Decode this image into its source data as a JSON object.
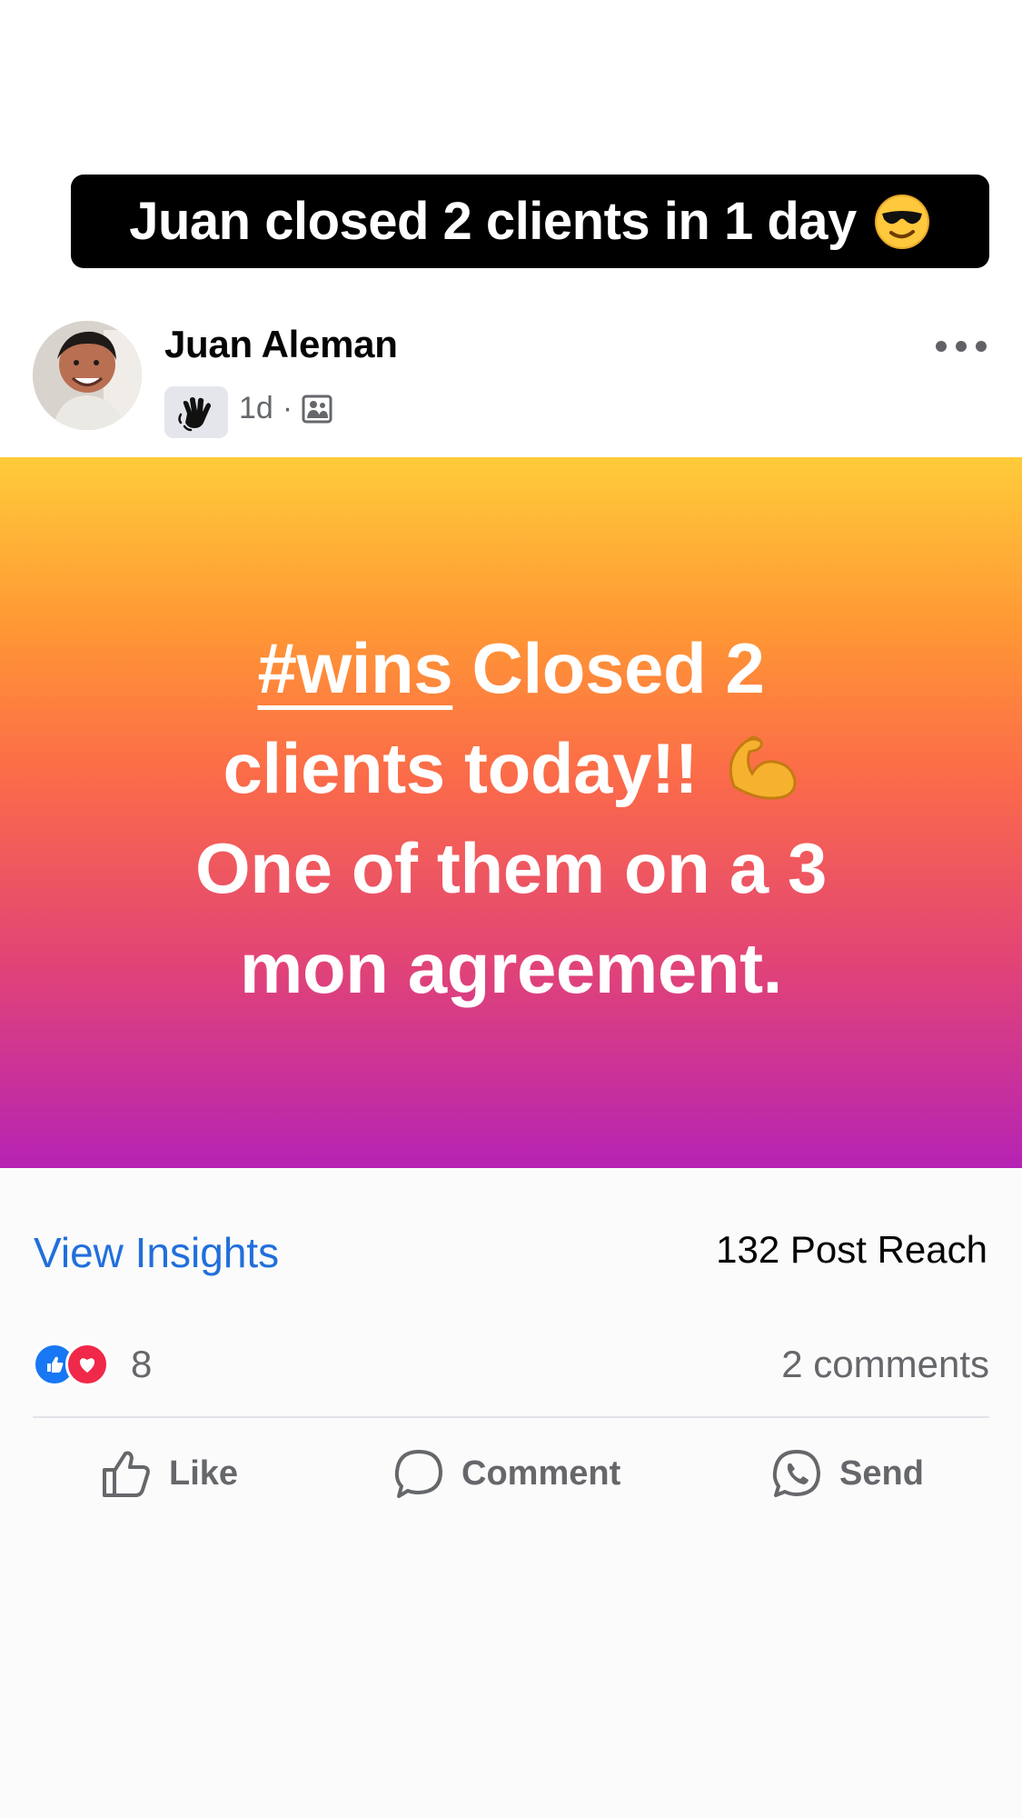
{
  "caption": {
    "text": "Juan closed 2 clients in 1 day",
    "emoji_icon": "sunglasses-face"
  },
  "post": {
    "author": "Juan Aleman",
    "time": "1d",
    "separator": "·",
    "badge_icon": "waving-hand",
    "audience_icon": "group-photo",
    "menu_icon": "more-dots",
    "content": {
      "hashtag": "#wins",
      "line1_rest": " Closed 2",
      "line2": "clients today!! ",
      "line3": "One of them on a 3",
      "line4": "mon agreement.",
      "emoji_icon": "flexed-biceps"
    },
    "background_colors": [
      "#ffcc3a",
      "#fb6b49",
      "#b623b4"
    ]
  },
  "insights": {
    "link_label": "View Insights",
    "reach_label": "132 Post Reach"
  },
  "engagement": {
    "reactions_count": "8",
    "comments_label": "2 comments",
    "reaction_icons": [
      "like",
      "love"
    ]
  },
  "actions": {
    "like_label": "Like",
    "comment_label": "Comment",
    "send_label": "Send"
  },
  "colors": {
    "link_blue": "#216fdb",
    "like_blue": "#1877f2",
    "love_red": "#f02849",
    "secondary_text": "#65676b"
  }
}
